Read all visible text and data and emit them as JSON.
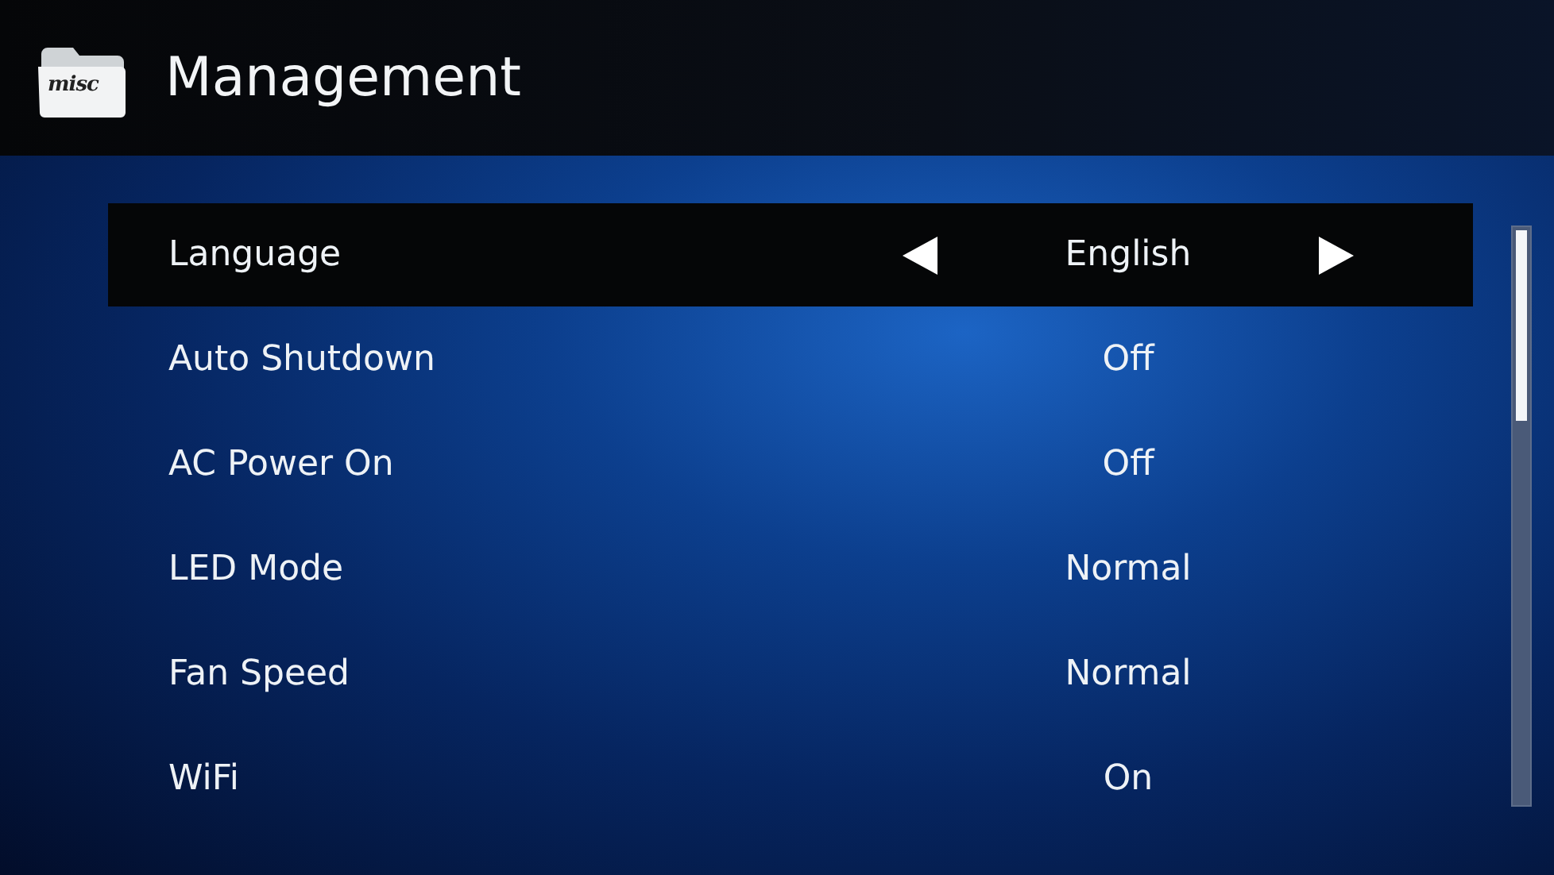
{
  "header": {
    "icon_label": "misc",
    "title": "Management"
  },
  "settings": [
    {
      "label": "Language",
      "value": "English",
      "selected": true
    },
    {
      "label": "Auto Shutdown",
      "value": "Off",
      "selected": false
    },
    {
      "label": "AC Power On",
      "value": "Off",
      "selected": false
    },
    {
      "label": "LED Mode",
      "value": "Normal",
      "selected": false
    },
    {
      "label": "Fan Speed",
      "value": "Normal",
      "selected": false
    },
    {
      "label": "WiFi",
      "value": "On",
      "selected": false
    }
  ]
}
